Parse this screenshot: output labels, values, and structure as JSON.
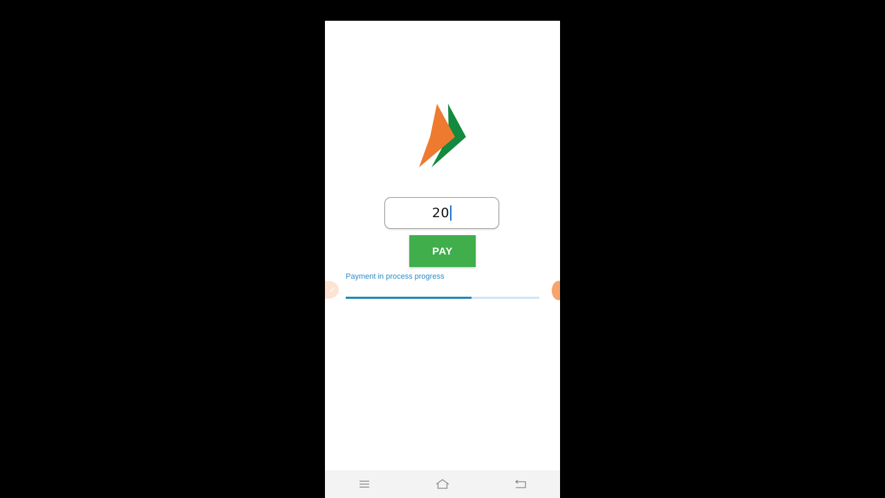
{
  "amount": {
    "value": "20"
  },
  "pay_button": {
    "label": "PAY"
  },
  "progress": {
    "label": "Payment in process progress",
    "percent": 65
  },
  "colors": {
    "logo_orange": "#ee7a30",
    "logo_green": "#138a3e",
    "pay_green": "#3fae4b",
    "progress_blue": "#1f87b8",
    "progress_track": "#cfe6f2"
  },
  "nav": {
    "icons": [
      "menu-icon",
      "home-icon",
      "back-icon"
    ]
  }
}
